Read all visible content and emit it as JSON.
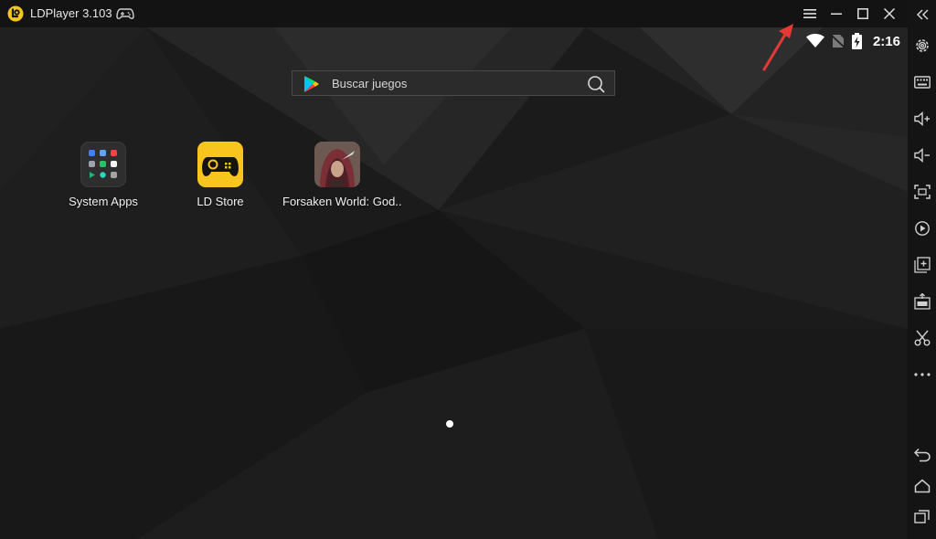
{
  "window": {
    "title": "LDPlayer 3.103"
  },
  "status_bar": {
    "time": "2:16"
  },
  "search": {
    "placeholder": "Buscar juegos"
  },
  "apps": [
    {
      "label": "System Apps"
    },
    {
      "label": "LD Store"
    },
    {
      "label": "Forsaken World: God.."
    }
  ],
  "colors": {
    "accent_yellow": "#f7c51e",
    "annotation_red": "#e53935",
    "titlebar_bg": "#131313",
    "toolbar_bg": "#141414"
  }
}
